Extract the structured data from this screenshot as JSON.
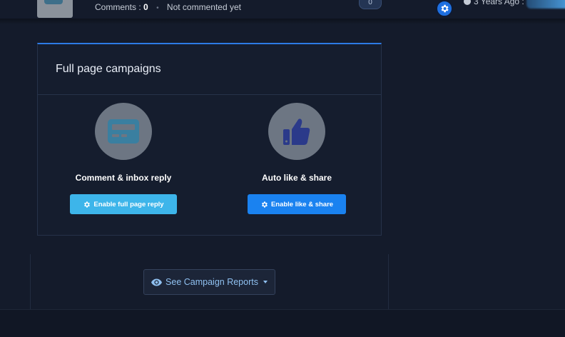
{
  "post": {
    "comments_label": "Comments :",
    "comments_count": "0",
    "separator": "•",
    "comment_status": "Not commented yet",
    "badge_count": "0",
    "time_ago": "3 Years Ago :"
  },
  "card": {
    "title": "Full page campaigns",
    "left": {
      "icon": "card-icon",
      "label": "Comment & inbox reply",
      "button_label": "Enable full page reply",
      "button_color": "#3db5ea"
    },
    "right": {
      "icon": "thumbs-up-icon",
      "label": "Auto like & share",
      "button_label": "Enable like & share",
      "button_color": "#1a82f0"
    },
    "accent": "#2c7be5"
  },
  "reports": {
    "label": "See Campaign Reports",
    "icon": "eye-icon"
  }
}
